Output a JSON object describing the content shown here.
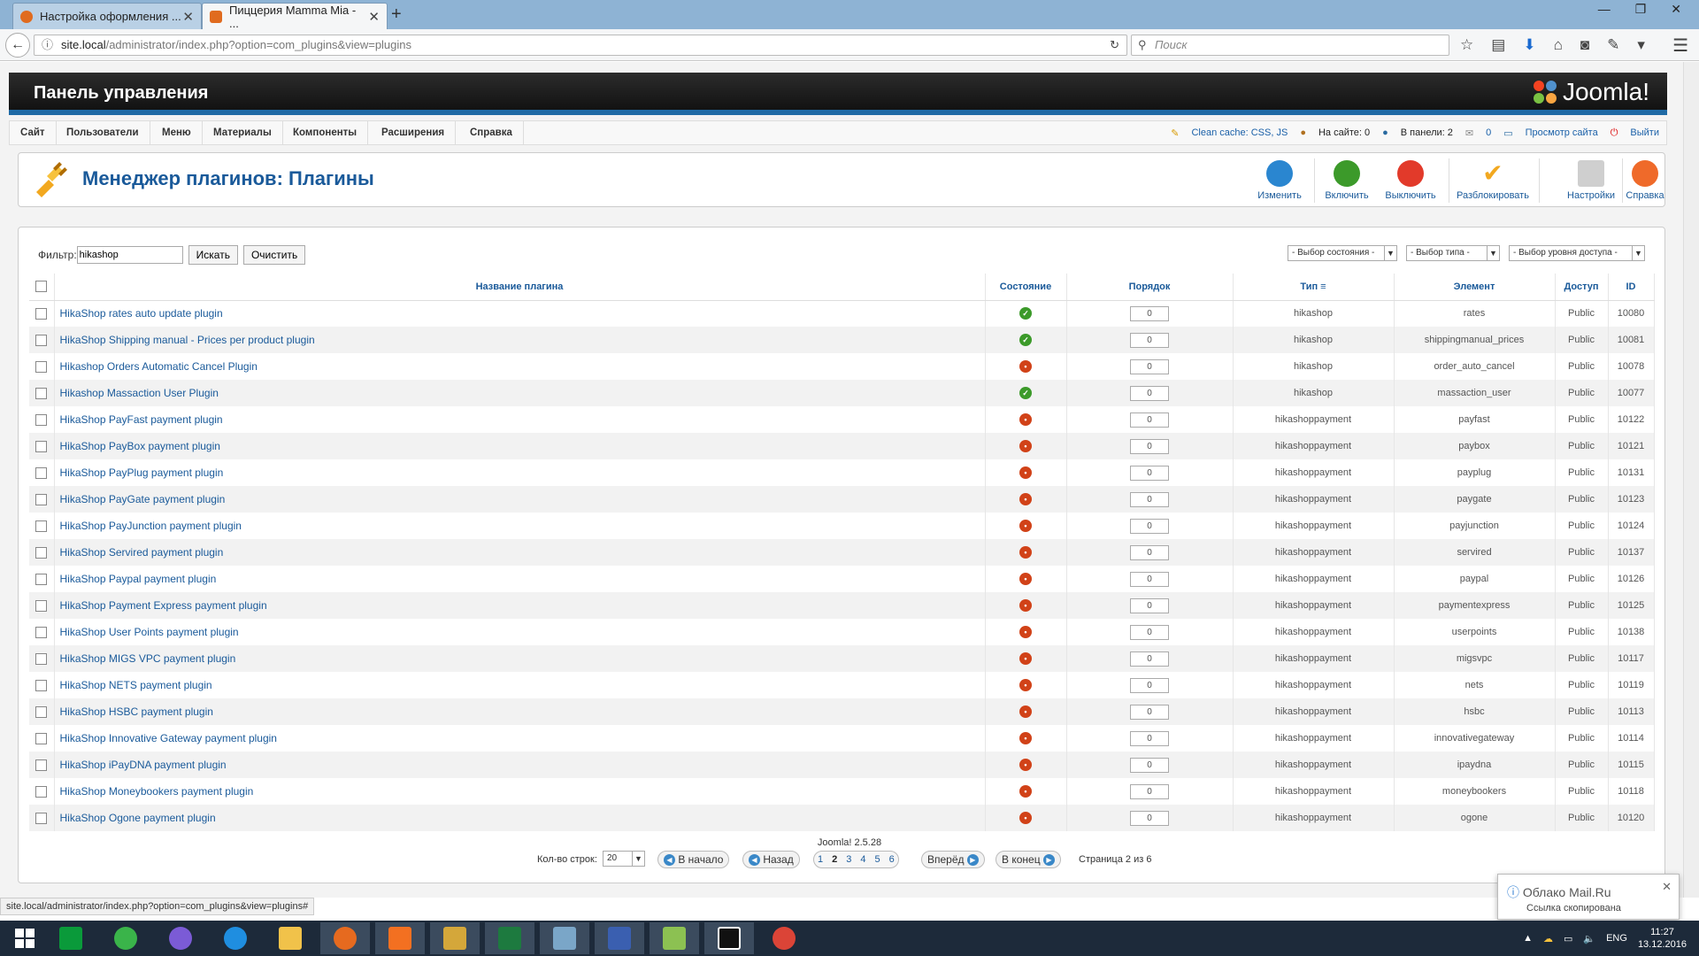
{
  "browser": {
    "tabs": [
      {
        "label": "Настройка оформления ...",
        "active": false
      },
      {
        "label": "Пиццерия Mamma Mia - ...",
        "active": true
      }
    ],
    "url_host": "site.local",
    "url_path": "/administrator/index.php?option=com_plugins&view=plugins",
    "search_placeholder": "Поиск",
    "status_url": "site.local/administrator/index.php?option=com_plugins&view=plugins#"
  },
  "admin": {
    "header_title": "Панель управления",
    "brand": "Joomla!",
    "menu": [
      "Сайт",
      "Пользователи",
      "Меню",
      "Материалы",
      "Компоненты",
      "Расширения",
      "Справка"
    ],
    "status": {
      "cache": "Clean cache: CSS, JS",
      "on_site": "На сайте: 0",
      "in_panel": "В панели: 2",
      "messages": "0",
      "view_site": "Просмотр сайта",
      "logout": "Выйти"
    },
    "page_title": "Менеджер плагинов: Плагины",
    "toolbar": [
      "Изменить",
      "Включить",
      "Выключить",
      "Разблокировать",
      "Настройки",
      "Справка"
    ],
    "filter": {
      "label": "Фильтр:",
      "value": "hikashop",
      "search_btn": "Искать",
      "clear_btn": "Очистить",
      "state_select": "- Выбор состояния -",
      "type_select": "- Выбор типа -",
      "access_select": "- Выбор уровня доступа -"
    },
    "columns": [
      "Название плагина",
      "Состояние",
      "Порядок",
      "Тип",
      "Элемент",
      "Доступ",
      "ID"
    ],
    "rows": [
      {
        "name": "HikaShop rates auto update plugin",
        "enabled": true,
        "order": "0",
        "type": "hikashop",
        "element": "rates",
        "access": "Public",
        "id": "10080"
      },
      {
        "name": "HikaShop Shipping manual - Prices per product plugin",
        "enabled": true,
        "order": "0",
        "type": "hikashop",
        "element": "shippingmanual_prices",
        "access": "Public",
        "id": "10081"
      },
      {
        "name": "Hikashop Orders Automatic Cancel Plugin",
        "enabled": false,
        "order": "0",
        "type": "hikashop",
        "element": "order_auto_cancel",
        "access": "Public",
        "id": "10078"
      },
      {
        "name": "Hikashop Massaction User Plugin",
        "enabled": true,
        "order": "0",
        "type": "hikashop",
        "element": "massaction_user",
        "access": "Public",
        "id": "10077"
      },
      {
        "name": "HikaShop PayFast payment plugin",
        "enabled": false,
        "order": "0",
        "type": "hikashoppayment",
        "element": "payfast",
        "access": "Public",
        "id": "10122"
      },
      {
        "name": "HikaShop PayBox payment plugin",
        "enabled": false,
        "order": "0",
        "type": "hikashoppayment",
        "element": "paybox",
        "access": "Public",
        "id": "10121"
      },
      {
        "name": "HikaShop PayPlug payment plugin",
        "enabled": false,
        "order": "0",
        "type": "hikashoppayment",
        "element": "payplug",
        "access": "Public",
        "id": "10131"
      },
      {
        "name": "HikaShop PayGate payment plugin",
        "enabled": false,
        "order": "0",
        "type": "hikashoppayment",
        "element": "paygate",
        "access": "Public",
        "id": "10123"
      },
      {
        "name": "HikaShop PayJunction payment plugin",
        "enabled": false,
        "order": "0",
        "type": "hikashoppayment",
        "element": "payjunction",
        "access": "Public",
        "id": "10124"
      },
      {
        "name": "HikaShop Servired payment plugin",
        "enabled": false,
        "order": "0",
        "type": "hikashoppayment",
        "element": "servired",
        "access": "Public",
        "id": "10137"
      },
      {
        "name": "HikaShop Paypal payment plugin",
        "enabled": false,
        "order": "0",
        "type": "hikashoppayment",
        "element": "paypal",
        "access": "Public",
        "id": "10126"
      },
      {
        "name": "HikaShop Payment Express payment plugin",
        "enabled": false,
        "order": "0",
        "type": "hikashoppayment",
        "element": "paymentexpress",
        "access": "Public",
        "id": "10125"
      },
      {
        "name": "HikaShop User Points payment plugin",
        "enabled": false,
        "order": "0",
        "type": "hikashoppayment",
        "element": "userpoints",
        "access": "Public",
        "id": "10138"
      },
      {
        "name": "HikaShop MIGS VPC payment plugin",
        "enabled": false,
        "order": "0",
        "type": "hikashoppayment",
        "element": "migsvpc",
        "access": "Public",
        "id": "10117"
      },
      {
        "name": "HikaShop NETS payment plugin",
        "enabled": false,
        "order": "0",
        "type": "hikashoppayment",
        "element": "nets",
        "access": "Public",
        "id": "10119"
      },
      {
        "name": "HikaShop HSBC payment plugin",
        "enabled": false,
        "order": "0",
        "type": "hikashoppayment",
        "element": "hsbc",
        "access": "Public",
        "id": "10113"
      },
      {
        "name": "HikaShop Innovative Gateway payment plugin",
        "enabled": false,
        "order": "0",
        "type": "hikashoppayment",
        "element": "innovativegateway",
        "access": "Public",
        "id": "10114"
      },
      {
        "name": "HikaShop iPayDNA payment plugin",
        "enabled": false,
        "order": "0",
        "type": "hikashoppayment",
        "element": "ipaydna",
        "access": "Public",
        "id": "10115"
      },
      {
        "name": "HikaShop Moneybookers payment plugin",
        "enabled": false,
        "order": "0",
        "type": "hikashoppayment",
        "element": "moneybookers",
        "access": "Public",
        "id": "10118"
      },
      {
        "name": "HikaShop Ogone payment plugin",
        "enabled": false,
        "order": "0",
        "type": "hikashoppayment",
        "element": "ogone",
        "access": "Public",
        "id": "10120"
      }
    ],
    "pager": {
      "rows_label": "Кол-во строк:",
      "rows_value": "20",
      "first": "В начало",
      "prev": "Назад",
      "pages": [
        "1",
        "2",
        "3",
        "4",
        "5",
        "6"
      ],
      "current_page": "2",
      "next": "Вперёд",
      "last": "В конец",
      "page_info": "Страница 2 из 6"
    },
    "version": "Joomla! 2.5.28"
  },
  "notification": {
    "title": "Облако Mail.Ru",
    "text": "Ссылка скопирована"
  },
  "tray": {
    "lang": "ENG",
    "time": "11:27",
    "date": "13.12.2016"
  },
  "colors": {
    "accent": "#1a5a9a",
    "enabled": "#3c9a2a",
    "disabled": "#d14218",
    "header_bar": "#1f6aa5"
  }
}
